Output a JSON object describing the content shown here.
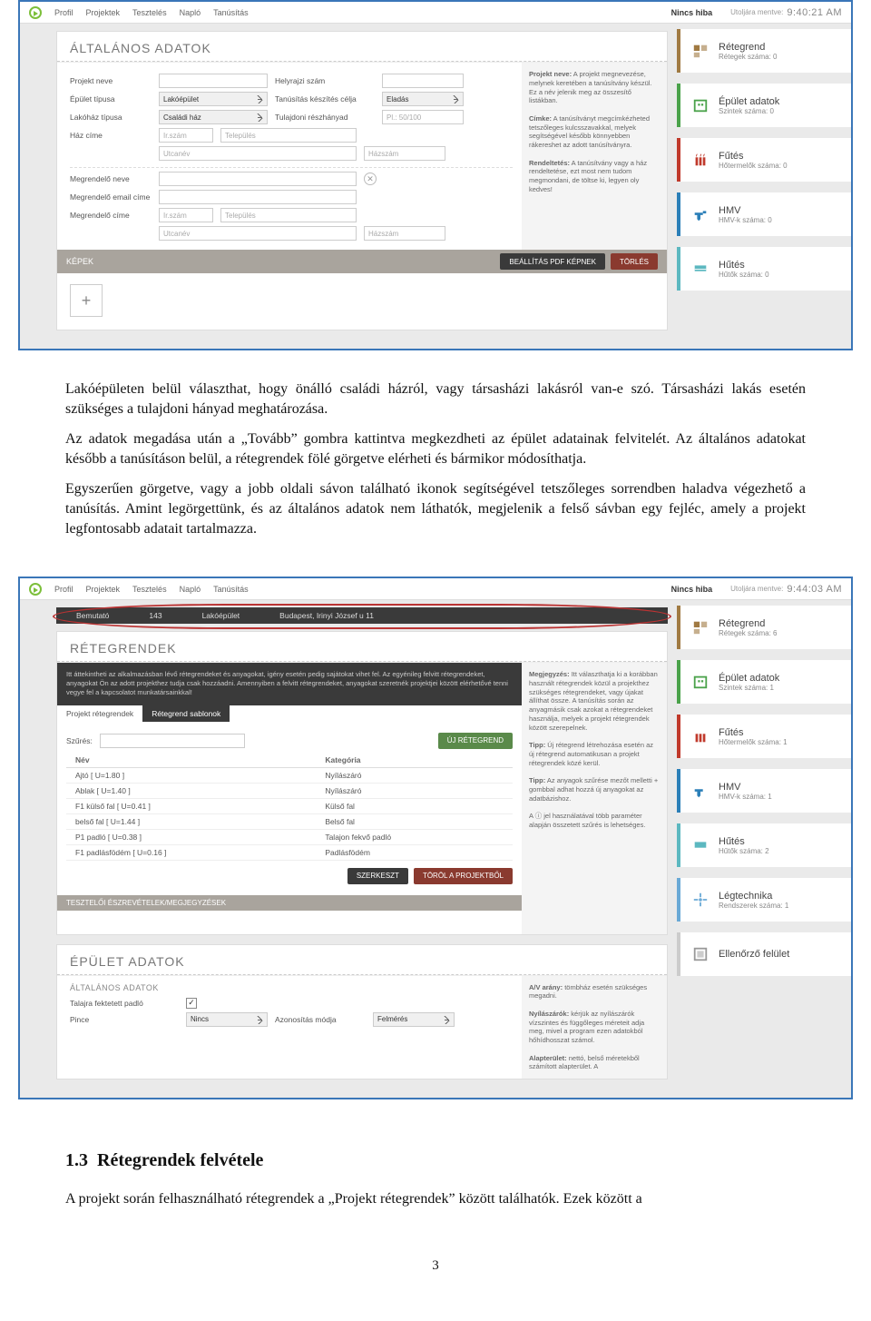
{
  "topbar": {
    "menu": [
      "Profil",
      "Projektek",
      "Tesztelés",
      "Napló",
      "Tanúsítás"
    ],
    "no_error": "Nincs hiba",
    "saved_label": "Utoljára mentve:"
  },
  "shot1": {
    "saved_time": "9:40:21 AM",
    "panel_title": "ÁLTALÁNOS ADATOK",
    "labels": {
      "projekt_neve": "Projekt neve",
      "helyrajzi": "Helyrajzi szám",
      "epulet_tipusa": "Épület típusa",
      "tan_keszites": "Tanúsítás készítés célja",
      "lakohaz_tipusa": "Lakóház típusa",
      "tul_reszhanyad": "Tulajdoni részhányad",
      "haz_cime": "Ház címe",
      "megrendelo_neve": "Megrendelő neve",
      "megrendelo_email": "Megrendelő email címe",
      "megrendelo_cime": "Megrendelő címe"
    },
    "values": {
      "epulet_tipusa": "Lakóépület",
      "tan_keszites": "Eladás",
      "lakohaz_tipusa": "Családi ház"
    },
    "placeholders": {
      "reszhanyad": "Pl.: 50/100",
      "irszam": "Ir.szám",
      "telepules": "Település",
      "utcanev": "Utcanév",
      "hazszam": "Házszám"
    },
    "info": {
      "p1_b": "Projekt neve:",
      "p1": " A projekt megnevezése, melynek keretében a tanúsítvány készül. Ez a név jelenik meg az összesítő listákban.",
      "p2_b": "Címke:",
      "p2": " A tanúsítványt megcímkézheted tetszőleges kulcsszavakkal, melyek segítségével később könnyebben rákereshet az adott tanúsítványra.",
      "p3_b": "Rendeltetés:",
      "p3": " A tanúsítvány vagy a ház rendeltetése, ezt most nem tudom megmondani, de töltse ki, legyen oly kedves!"
    },
    "kepek": "KÉPEK",
    "btn_pdf": "BEÁLLÍTÁS PDF KÉPNEK",
    "btn_del": "TÖRLÉS",
    "side": [
      {
        "title": "Rétegrend",
        "sub": "Rétegek száma: 0"
      },
      {
        "title": "Épület adatok",
        "sub": "Szintek száma: 0"
      },
      {
        "title": "Fűtés",
        "sub": "Hőtermelők száma: 0"
      },
      {
        "title": "HMV",
        "sub": "HMV-k száma: 0"
      },
      {
        "title": "Hűtés",
        "sub": "Hűtők száma: 0"
      }
    ]
  },
  "body_text": {
    "p1": "Lakóépületen belül választhat, hogy önálló családi házról, vagy társasházi lakásról van-e szó. Társasházi lakás esetén szükséges a tulajdoni hányad meghatározása.",
    "p2": "Az adatok megadása után a „Tovább” gombra kattintva megkezdheti az épület adatainak felvitelét. Az általános adatokat később a tanúsításon belül, a rétegrendek fölé görgetve elérheti és bármikor módosíthatja.",
    "p3": "Egyszerűen görgetve, vagy a jobb oldali sávon található ikonok segítségével tetszőleges sorrendben haladva végezhető a tanúsítás. Amint legörgettünk, és az általános adatok nem láthatók, megjelenik a felső sávban egy fejléc, amely a projekt legfontosabb adatait tartalmazza."
  },
  "shot2": {
    "saved_time": "9:44:03 AM",
    "crumbs": [
      "Bemutató",
      "143",
      "Lakóépület",
      "Budapest, Irinyi József u 11"
    ],
    "panel1_title": "RÉTEGRENDEK",
    "dark_intro": "Itt áttekintheti az alkalmazásban lévő rétegrendeket és anyagokat, igény esetén pedig sajátokat vihet fel. Az egyénileg felvitt rétegrendeket, anyagokat Ön az adott projekthez tudja csak hozzáadni. Amennyiben a felvitt rétegrendeket, anyagokat szeretnék projektjei között elérhetővé tenni vegye fel a kapcsolatot munkatársainkkal!",
    "tabs": [
      "Projekt rétegrendek",
      "Rétegrend sablonok"
    ],
    "filter_label": "Szűrés:",
    "btn_new": "ÚJ RÉTEGREND",
    "cols": {
      "name": "Név",
      "cat": "Kategória"
    },
    "rows": [
      {
        "n": "Ajtó [ U=1.80 ]",
        "c": "Nyílászáró"
      },
      {
        "n": "Ablak [ U=1.40 ]",
        "c": "Nyílászáró"
      },
      {
        "n": "F1 külső fal [ U=0.41 ]",
        "c": "Külső fal"
      },
      {
        "n": "belső fal [ U=1.44 ]",
        "c": "Belső fal"
      },
      {
        "n": "P1 padló [ U=0.38 ]",
        "c": "Talajon fekvő padló"
      },
      {
        "n": "F1 padlásfödém [ U=0.16 ]",
        "c": "Padlásfödém"
      }
    ],
    "btn_edit": "SZERKESZT",
    "btn_delproj": "TÖRÖL A PROJEKTBŐL",
    "notes": "TESZTELŐI ÉSZREVÉTELEK/MEGJEGYZÉSEK",
    "info1": {
      "b1": "Megjegyzés:",
      "t1": " Itt választhatja ki a korábban használt rétegrendek közül a projekthez szükséges rétegrendeket, vagy újakat állíthat össze. A tanúsítás során az anyagmásik csak azokat a rétegrendeket használja, melyek a projekt rétegrendek között szerepelnek.",
      "b2": "Tipp:",
      "t2": " Új rétegrend létrehozása esetén az új rétegrend automatikusan a projekt rétegrendek közé kerül.",
      "b3": "Tipp:",
      "t3": " Az anyagok szűrése mezőt melletti + gombbal adhat hozzá új anyagokat az adatbázishoz.",
      "t4": "A ⓘ jel használatával több paraméter alapján összetett szűrés is lehetséges."
    },
    "panel2_title": "ÉPÜLET ADATOK",
    "panel2_sub": "ÁLTALÁNOS ADATOK",
    "labels2": {
      "padlo": "Talajra fektetett padló",
      "pince": "Pince",
      "azon": "Azonosítás módja"
    },
    "values2": {
      "pince": "Nincs",
      "azon": "Felmérés"
    },
    "info2": {
      "b1": "A/V arány:",
      "t1": " tömbház esetén szükséges megadni.",
      "b2": "Nyílászárók:",
      "t2": " kérjük az nyílászárók vízszintes és függőleges méreteit adja meg, mivel a program ezen adatokból hőhídhosszat számol.",
      "b3": "Alapterület:",
      "t3": " nettó, belső méretekből számított alapterület. A"
    },
    "side": [
      {
        "title": "Rétegrend",
        "sub": "Rétegek száma: 6"
      },
      {
        "title": "Épület adatok",
        "sub": "Szintek száma: 1"
      },
      {
        "title": "Fűtés",
        "sub": "Hőtermelők száma: 1"
      },
      {
        "title": "HMV",
        "sub": "HMV-k száma: 1"
      },
      {
        "title": "Hűtés",
        "sub": "Hűtők száma: 2"
      },
      {
        "title": "Légtechnika",
        "sub": "Rendszerek száma: 1"
      },
      {
        "title": "Ellenőrző felület",
        "sub": ""
      }
    ]
  },
  "section": {
    "num": "1.3",
    "title": "Rétegrendek felvétele"
  },
  "last_p": "A projekt során felhasználható rétegrendek a „Projekt rétegrendek” között találhatók. Ezek között a",
  "page": "3"
}
